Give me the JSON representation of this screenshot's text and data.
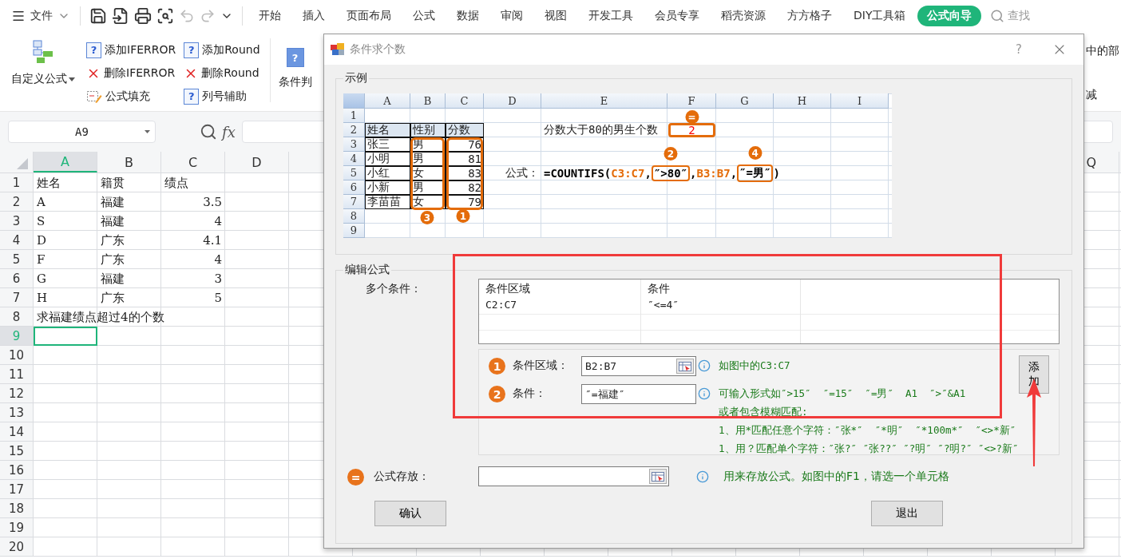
{
  "topbar": {
    "menu_label": "文件",
    "tabs": [
      {
        "label": "开始",
        "selected": false
      },
      {
        "label": "插入",
        "selected": false
      },
      {
        "label": "页面布局",
        "selected": false
      },
      {
        "label": "公式",
        "selected": false
      },
      {
        "label": "数据",
        "selected": false
      },
      {
        "label": "审阅",
        "selected": false
      },
      {
        "label": "视图",
        "selected": false
      },
      {
        "label": "开发工具",
        "selected": false
      },
      {
        "label": "会员专享",
        "selected": false
      },
      {
        "label": "稻壳资源",
        "selected": false
      },
      {
        "label": "方方格子",
        "selected": false
      },
      {
        "label": "DIY工具箱",
        "selected": false
      },
      {
        "label": "公式向导",
        "selected": true
      }
    ],
    "search_label": "查找"
  },
  "ribbon": {
    "main_button": "自定义公式",
    "commands": [
      {
        "kind": "help",
        "icon": "?",
        "label": "添加IFERROR"
      },
      {
        "kind": "delete",
        "label": "删除IFERROR"
      },
      {
        "kind": "fill",
        "label": "公式填充"
      },
      {
        "kind": "help",
        "icon": "?",
        "label": "添加Round"
      },
      {
        "kind": "delete",
        "label": "删除Round"
      },
      {
        "kind": "help",
        "icon": "?",
        "label": "列号辅助"
      }
    ],
    "cut_button": {
      "icon": "?",
      "label": "条件判"
    },
    "edge_texts": [
      "中的部",
      "减"
    ]
  },
  "formula_bar": {
    "cell_ref": "A9",
    "function_label": "fx"
  },
  "sheet": {
    "columns": [
      {
        "label": "A",
        "selected": true
      },
      {
        "label": "B",
        "selected": false
      },
      {
        "label": "C",
        "selected": false
      },
      {
        "label": "D",
        "selected": false
      }
    ],
    "far_column": {
      "label": "Q",
      "selected": false
    },
    "rows": [
      {
        "number": "1",
        "selected": false,
        "numeric": false,
        "a": "姓名",
        "b": "籍贯",
        "c": "绩点"
      },
      {
        "number": "2",
        "selected": false,
        "numeric": true,
        "a": "A",
        "b": "福建",
        "c": "3.5"
      },
      {
        "number": "3",
        "selected": false,
        "numeric": true,
        "a": "S",
        "b": "福建",
        "c": "4"
      },
      {
        "number": "4",
        "selected": false,
        "numeric": true,
        "a": "D",
        "b": "广东",
        "c": "4.1"
      },
      {
        "number": "5",
        "selected": false,
        "numeric": true,
        "a": "F",
        "b": "广东",
        "c": "4"
      },
      {
        "number": "6",
        "selected": false,
        "numeric": true,
        "a": "G",
        "b": "福建",
        "c": "3"
      },
      {
        "number": "7",
        "selected": false,
        "numeric": true,
        "a": "H",
        "b": "广东",
        "c": "5"
      },
      {
        "number": "8",
        "selected": false,
        "a": "求福建绩点超过4的个数"
      },
      {
        "number": "9",
        "selected": true
      },
      {
        "number": "10",
        "selected": false
      },
      {
        "number": "11",
        "selected": false
      },
      {
        "number": "12",
        "selected": false
      },
      {
        "number": "13",
        "selected": false
      },
      {
        "number": "14",
        "selected": false
      },
      {
        "number": "15",
        "selected": false
      },
      {
        "number": "16",
        "selected": false
      },
      {
        "number": "17",
        "selected": false
      },
      {
        "number": "18",
        "selected": false
      },
      {
        "number": "19",
        "selected": false
      },
      {
        "number": "20",
        "selected": false
      }
    ]
  },
  "dialog": {
    "title": "条件求个数",
    "help": "?",
    "example": {
      "legend": "示例",
      "columns": [
        "A",
        "B",
        "C",
        "D",
        "E",
        "F",
        "G",
        "H",
        "I"
      ],
      "b_marker": "3",
      "c_marker": "1",
      "rows": [
        {
          "number": "1"
        },
        {
          "number": "2",
          "in_table": true,
          "header": true,
          "a": "姓名",
          "b": "性别",
          "c": "分数",
          "e": "分数大于80的男生个数",
          "f": "2",
          "f_marker": "="
        },
        {
          "number": "3",
          "in_table": true,
          "header": false,
          "a": "张三",
          "b": "男",
          "c": "76"
        },
        {
          "number": "4",
          "in_table": true,
          "header": false,
          "a": "小明",
          "b": "男",
          "c": "81"
        },
        {
          "number": "5",
          "in_table": true,
          "header": false,
          "a": "小红",
          "b": "女",
          "c": "83",
          "d": "公式：",
          "formula": [
            {
              "text": "=COUNTIFS(",
              "kind": "plain"
            },
            {
              "text": "C3:C7",
              "kind": "ref"
            },
            {
              "text": ",",
              "kind": "plain"
            },
            {
              "text": "″>80″",
              "kind": "criterion",
              "marker": "2"
            },
            {
              "text": ",",
              "kind": "plain"
            },
            {
              "text": "B3:B7",
              "kind": "ref"
            },
            {
              "text": ",",
              "kind": "plain"
            },
            {
              "text": "″=男″",
              "kind": "criterion",
              "marker": "4"
            },
            {
              "text": ")",
              "kind": "plain"
            }
          ]
        },
        {
          "number": "6",
          "in_table": true,
          "header": false,
          "a": "小新",
          "b": "男",
          "c": "82"
        },
        {
          "number": "7",
          "in_table": true,
          "header": false,
          "a": "李苗苗",
          "b": "女",
          "c": "79"
        },
        {
          "number": "8"
        },
        {
          "number": "9"
        }
      ]
    },
    "editor": {
      "legend": "编辑公式",
      "list_label": "多个条件：",
      "list_columns": [
        "条件区域",
        "条件"
      ],
      "list_rows": [
        [
          "C2:C7",
          "″<=4″"
        ]
      ],
      "fields": [
        {
          "marker": "1",
          "label": "条件区域：",
          "value": "B2:B7",
          "picker": true,
          "hint": [
            "如图中的C3:C7"
          ]
        },
        {
          "marker": "2",
          "label": "条件：",
          "value": "″=福建″",
          "picker": false,
          "hint": [
            "可输入形式如″>15″  ″=15″  ″=男″  A1  ″>″&A1",
            "或者包含模糊匹配:",
            "1、用*匹配任意个字符：″张*″  ″*明″  ″*100m*″  ″<>*新″",
            "1、用？匹配单个字符：″张?″ ″张??″ ″?明″ ″?明?″ ″<>?新″"
          ]
        }
      ],
      "add_button": "添加",
      "store": {
        "marker": "=",
        "label": "公式存放：",
        "hint": "用来存放公式。如图中的F1，请选一个单元格"
      },
      "ok_button": "确认",
      "exit_button": "退出"
    }
  }
}
